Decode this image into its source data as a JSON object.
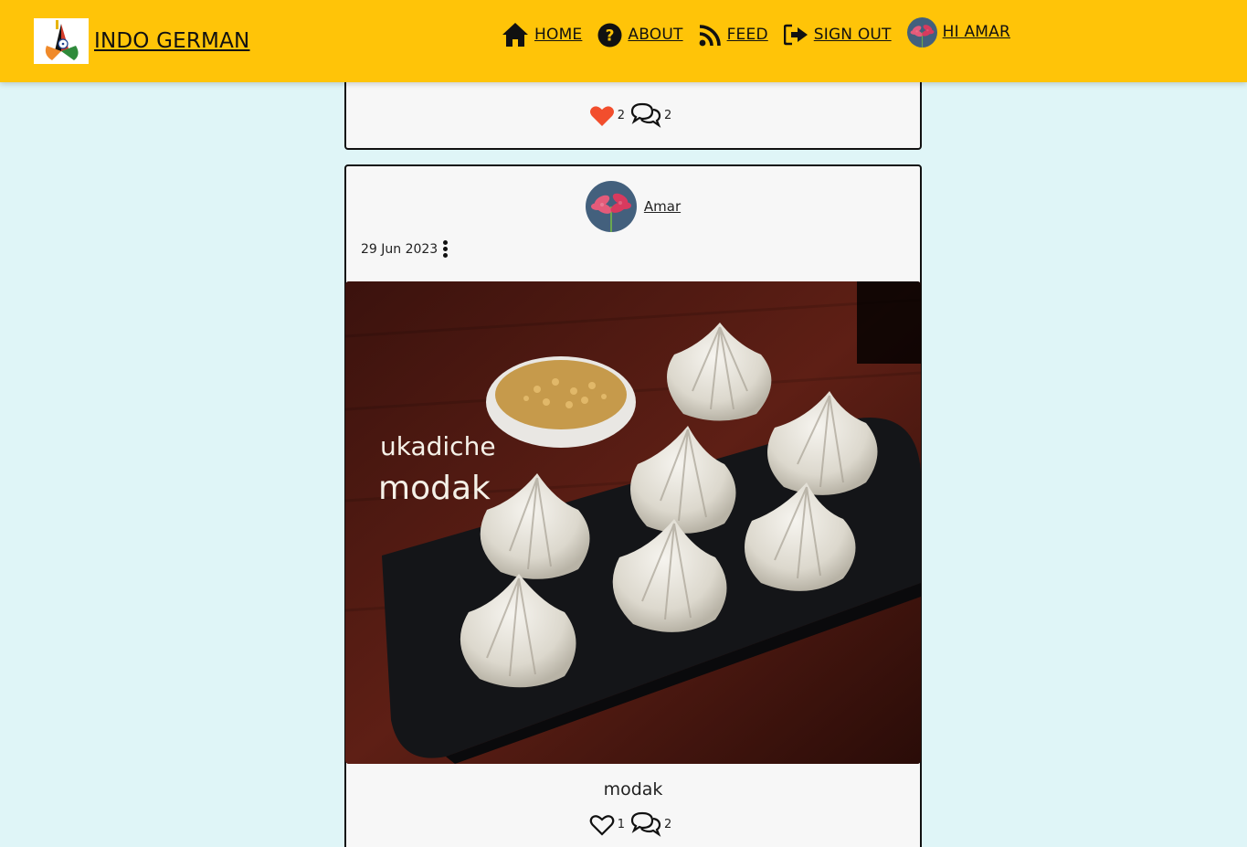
{
  "navbar": {
    "brand": "INDO GERMAN",
    "links": [
      {
        "label": "HOME",
        "icon": "home-icon"
      },
      {
        "label": "ABOUT",
        "icon": "question-circle-icon"
      },
      {
        "label": "FEED",
        "icon": "rss-icon"
      },
      {
        "label": "SIGN OUT",
        "icon": "sign-out-icon"
      }
    ],
    "user_label": "HI AMAR"
  },
  "posts": [
    {
      "likes": "2",
      "comments": "2",
      "liked": true
    },
    {
      "author": "Amar",
      "date": "29 Jun 2023",
      "image_text_line1": "ukadiche",
      "image_text_line2": "modak",
      "title": "modak",
      "likes": "1",
      "comments": "2",
      "liked": false
    }
  ],
  "colors": {
    "navbar_bg": "#ffc408",
    "page_bg": "#dff5f7",
    "card_bg": "#f7f7f7",
    "heart_liked": "#f24e2d"
  }
}
